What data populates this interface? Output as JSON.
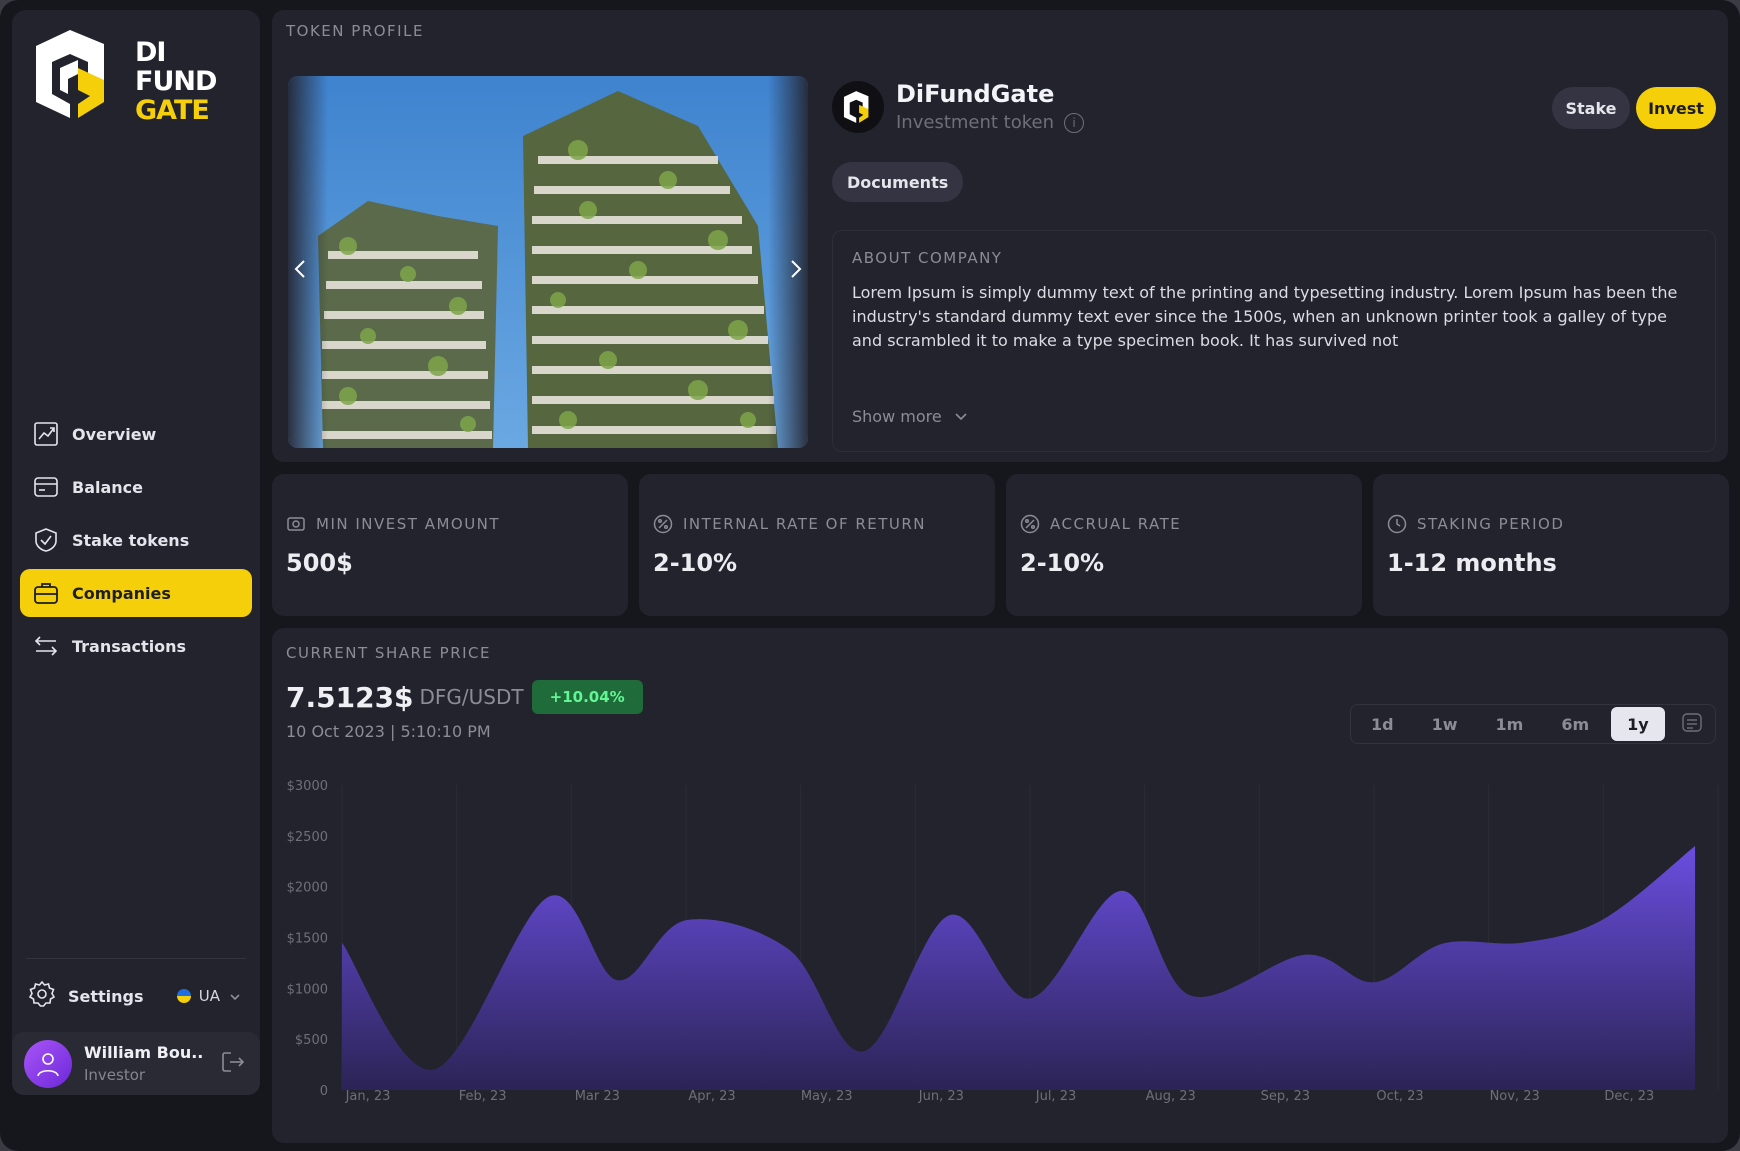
{
  "brand": {
    "logo_line1": "DI",
    "logo_line2": "FUND",
    "logo_line3": "GATE",
    "accent_color": "#f5cf0a"
  },
  "sidebar": {
    "items": [
      {
        "label": "Overview",
        "icon": "chart-line-icon",
        "active": false
      },
      {
        "label": "Balance",
        "icon": "wallet-icon",
        "active": false
      },
      {
        "label": "Stake tokens",
        "icon": "shield-check-icon",
        "active": false
      },
      {
        "label": "Companies",
        "icon": "briefcase-icon",
        "active": true
      },
      {
        "label": "Transactions",
        "icon": "swap-arrows-icon",
        "active": false
      }
    ],
    "settings_label": "Settings",
    "language": "UA",
    "user": {
      "name": "William Bou..",
      "role": "Investor"
    }
  },
  "token_profile": {
    "section_label": "TOKEN PROFILE",
    "name": "DiFundGate",
    "subtitle": "Investment token",
    "documents_label": "Documents",
    "stake_label": "Stake",
    "invest_label": "Invest",
    "about": {
      "label": "ABOUT COMPANY",
      "text": "Lorem Ipsum is simply dummy text of the printing and typesetting industry. Lorem Ipsum has been the industry's standard dummy text ever since the 1500s, when an unknown printer took a galley of type and scrambled it to make a type specimen book. It has survived not",
      "show_more": "Show more"
    }
  },
  "stats": [
    {
      "label": "MIN INVEST AMOUNT",
      "value": "500$",
      "icon": "coins-icon"
    },
    {
      "label": "INTERNAL RATE OF RETURN",
      "value": "2-10%",
      "icon": "percent-icon"
    },
    {
      "label": "ACCRUAL RATE",
      "value": "2-10%",
      "icon": "percent-icon"
    },
    {
      "label": "STAKING PERIOD",
      "value": "1-12 months",
      "icon": "clock-icon"
    }
  ],
  "price": {
    "section_label": "CURRENT SHARE PRICE",
    "value": "7.5123$",
    "pair": "DFG/USDT",
    "change": "+10.04%",
    "timestamp": "10 Oct 2023 | 5:10:10 PM",
    "ranges": [
      "1d",
      "1w",
      "1m",
      "6m",
      "1y"
    ],
    "active_range": "1y",
    "change_color": "#63f593"
  },
  "chart_data": {
    "type": "area",
    "categories": [
      "Jan, 23",
      "Feb, 23",
      "Mar 23",
      "Apr, 23",
      "May, 23",
      "Jun, 23",
      "Jul, 23",
      "Aug, 23",
      "Sep, 23",
      "Oct, 23",
      "Nov, 23",
      "Dec, 23"
    ],
    "y_ticks": [
      "$3000",
      "$2500",
      "$2000",
      "$1500",
      "$1000",
      "$500",
      "0"
    ],
    "ylim": [
      0,
      3000
    ],
    "x": [
      0,
      0.8,
      1.8,
      2.4,
      3.0,
      3.9,
      4.55,
      5.3,
      6.0,
      6.8,
      7.4,
      8.4,
      9.0,
      9.6,
      10.3,
      11.0,
      11.8
    ],
    "values": [
      1450,
      200,
      1900,
      1080,
      1670,
      1380,
      380,
      1720,
      900,
      1960,
      930,
      1330,
      1060,
      1440,
      1450,
      1680,
      2400
    ],
    "fill_color": "#6a4ee0"
  }
}
